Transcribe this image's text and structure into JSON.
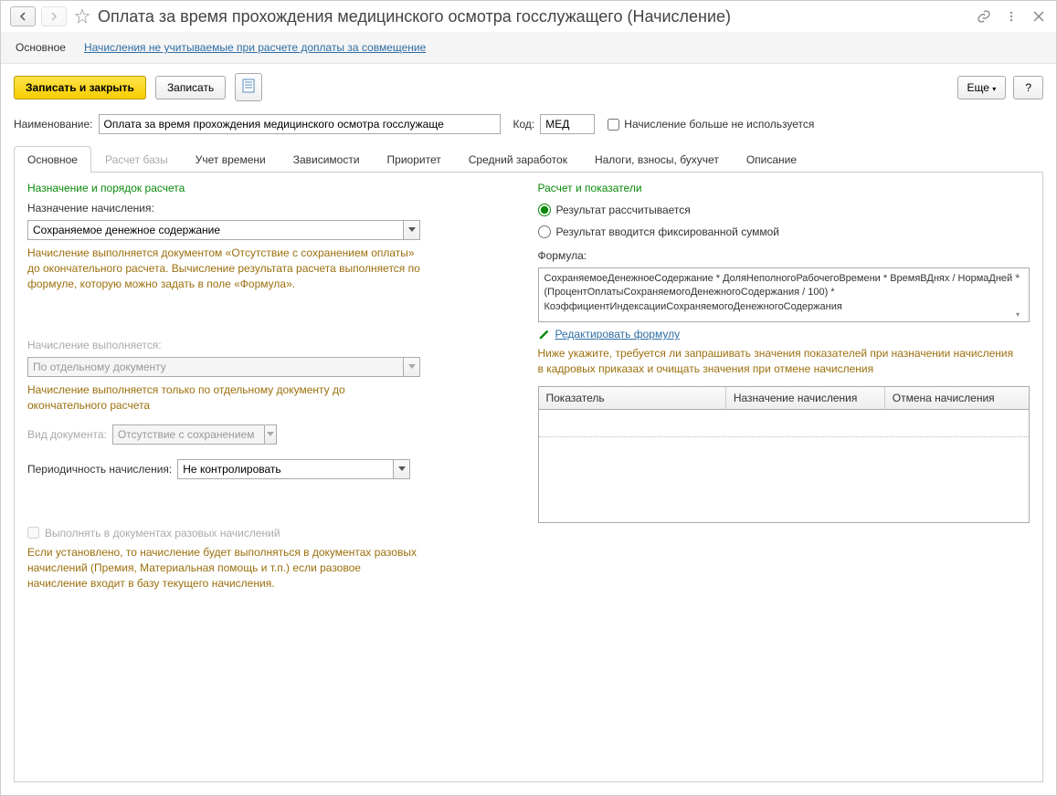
{
  "titlebar": {
    "title": "Оплата за время прохождения медицинского осмотра госслужащего (Начисление)"
  },
  "navbar": {
    "main": "Основное",
    "link": "Начисления не учитываемые при расчете доплаты за совмещение"
  },
  "toolbar": {
    "save_close": "Записать и закрыть",
    "save": "Записать",
    "more": "Еще",
    "help": "?"
  },
  "header_form": {
    "name_label": "Наименование:",
    "name_value": "Оплата за время прохождения медицинского осмотра госслужаще",
    "code_label": "Код:",
    "code_value": "МЕД",
    "notused_label": "Начисление больше не используется"
  },
  "tabs": [
    "Основное",
    "Расчет базы",
    "Учет времени",
    "Зависимости",
    "Приоритет",
    "Средний заработок",
    "Налоги, взносы, бухучет",
    "Описание"
  ],
  "left": {
    "section1_title": "Назначение и порядок расчета",
    "purpose_label": "Назначение начисления:",
    "purpose_value": "Сохраняемое денежное содержание",
    "purpose_note": "Начисление выполняется документом «Отсутствие с сохранением оплаты» до окончательного расчета. Вычисление результата расчета выполняется по формуле, которую можно задать в поле «Формула».",
    "exec_label": "Начисление выполняется:",
    "exec_value": "По отдельному документу",
    "exec_note": "Начисление выполняется только по отдельному документу до окончательного расчета",
    "doc_label": "Вид документа:",
    "doc_value": "Отсутствие с сохранением",
    "period_label": "Периодичность начисления:",
    "period_value": "Не контролировать",
    "onetime_label": "Выполнять в документах разовых начислений",
    "onetime_note": "Если установлено, то начисление будет выполняться в документах разовых начислений (Премия, Материальная помощь и т.п.) если разовое начисление входит в базу текущего начисления."
  },
  "right": {
    "section_title": "Расчет и показатели",
    "radio1": "Результат рассчитывается",
    "radio2": "Результат вводится фиксированной суммой",
    "formula_label": "Формула:",
    "formula_text": "СохраняемоеДенежноеСодержание * ДоляНеполногоРабочегоВремени * ВремяВДнях / НормаДней * (ПроцентОплатыСохраняемогоДенежногоСодержания / 100) * КоэффициентИндексацииСохраняемогоДенежногоСодержания",
    "edit_link": "Редактировать формулу",
    "hint": "Ниже укажите, требуется ли запрашивать значения показателей при назначении начисления в кадровых приказах и очищать значения при отмене начисления",
    "table_h1": "Показатель",
    "table_h2": "Назначение начисления",
    "table_h3": "Отмена начисления"
  }
}
